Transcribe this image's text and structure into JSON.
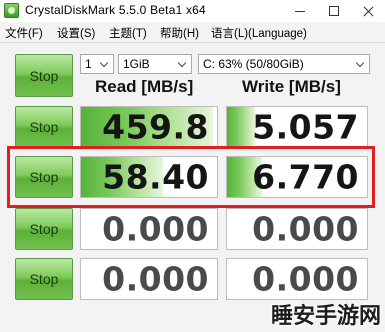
{
  "window": {
    "title": "CrystalDiskMark 5.5.0 Beta1 x64"
  },
  "menu": {
    "items": [
      "文件(F)",
      "设置(S)",
      "主题(T)",
      "帮助(H)",
      "语言(L)(Language)"
    ]
  },
  "controls": {
    "all_button_label": "Stop",
    "count_value": "1",
    "size_value": "1GiB",
    "drive_value": "C: 63% (50/80GiB)"
  },
  "columns": {
    "read_header": "Read [MB/s]",
    "write_header": "Write [MB/s]"
  },
  "rows": [
    {
      "button_label": "Stop",
      "read": "459.8",
      "write": "5.057",
      "read_fill_fraction": 0.97,
      "write_fill_fraction": 0.2
    },
    {
      "button_label": "Stop",
      "read": "58.40",
      "write": "6.770",
      "read_fill_fraction": 0.6,
      "write_fill_fraction": 0.25
    },
    {
      "button_label": "Stop",
      "read": "0.000",
      "write": "0.000",
      "read_fill_fraction": 0,
      "write_fill_fraction": 0
    },
    {
      "button_label": "Stop",
      "read": "0.000",
      "write": "0.000",
      "read_fill_fraction": 0,
      "write_fill_fraction": 0
    }
  ],
  "watermark": "睡安手游网",
  "colors": {
    "button_green": "#7fcb5b",
    "bar_green": "#56b33a",
    "highlight_red": "#e02020"
  }
}
